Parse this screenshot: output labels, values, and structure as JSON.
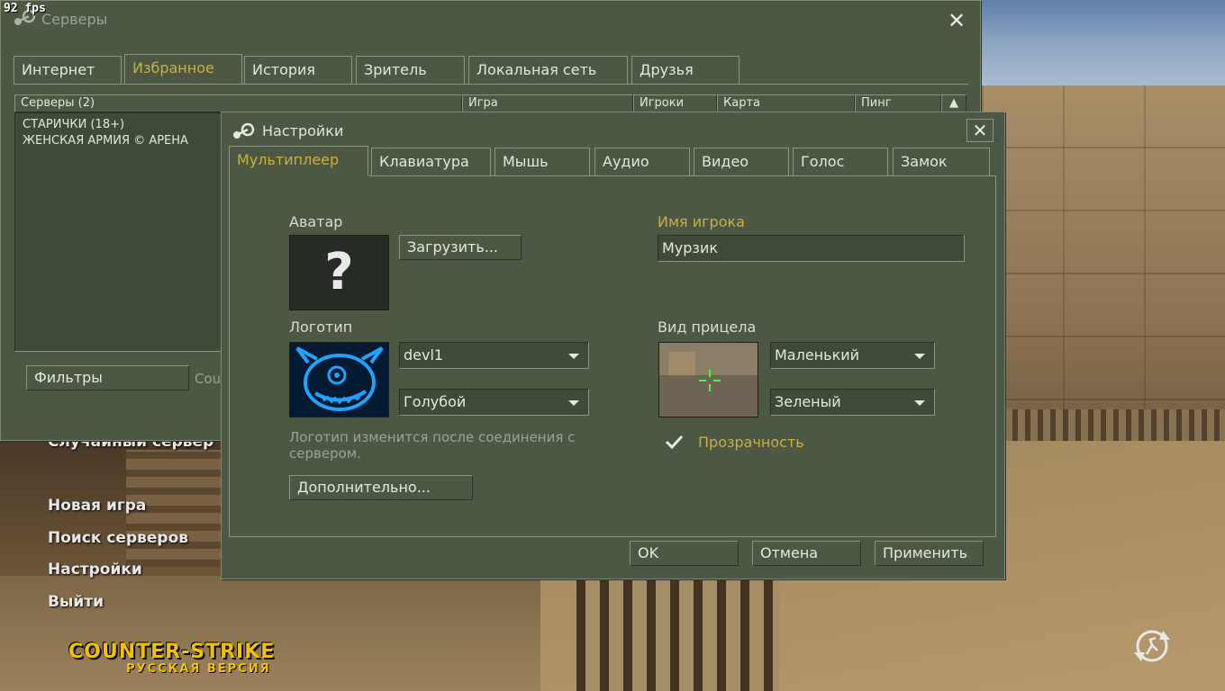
{
  "overlay": {
    "fps": "92 fps"
  },
  "main_menu": {
    "items": [
      "Случайный сервер",
      "Новая игра",
      "Поиск серверов",
      "Настройки",
      "Выйти"
    ],
    "logo_title": "COUNTER-STRIKE",
    "logo_subtitle": "РУССКАЯ ВЕРСИЯ"
  },
  "servers_window": {
    "title": "Серверы",
    "tabs": [
      "Интернет",
      "Избранное",
      "История",
      "Зритель",
      "Локальная сеть",
      "Друзья"
    ],
    "active_tab": "Избранное",
    "columns": [
      "Серверы (2)",
      "Игра",
      "Игроки",
      "Карта",
      "Пинг"
    ],
    "rows": [
      "СТАРИЧКИ (18+)",
      "ЖЕНСКАЯ АРМИЯ © АРЕНА"
    ],
    "filters_button": "Фильтры",
    "filter_status_partial": "Cou"
  },
  "settings_dialog": {
    "title": "Настройки",
    "tabs": [
      "Мультиплеер",
      "Клавиатура",
      "Мышь",
      "Аудио",
      "Видео",
      "Голос",
      "Замок"
    ],
    "active_tab": "Мультиплеер",
    "avatar_label": "Аватар",
    "avatar_placeholder": "?",
    "upload_button": "Загрузить...",
    "player_name_label": "Имя игрока",
    "player_name_value": "Мурзик",
    "logo_label": "Логотип",
    "logo_select": "devl1",
    "logo_color_select": "Голубой",
    "logo_note": "Логотип изменится после соединения с сервером.",
    "advanced_button": "Дополнительно...",
    "crosshair_label": "Вид прицела",
    "crosshair_size_select": "Маленький",
    "crosshair_color_select": "Зеленый",
    "transparency_label": "Прозрачность",
    "transparency_checked": true,
    "ok_button": "OK",
    "cancel_button": "Отмена",
    "apply_button": "Применить"
  },
  "colors": {
    "window_bg": "#4c5844",
    "accent_gold": "#c9b040",
    "logo_blue": "#1fa3ff",
    "crosshair_green": "#3cff3c"
  }
}
